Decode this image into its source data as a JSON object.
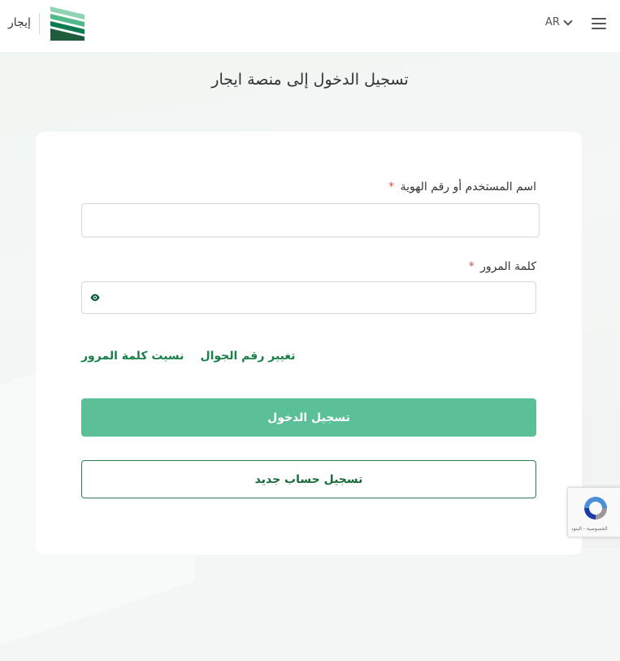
{
  "header": {
    "logo_text": "إيجار",
    "language": "AR",
    "menu_icon": "hamburger-menu-icon",
    "brand_colors": [
      "#0a7a4f",
      "#4fb98a",
      "#1f5c3d"
    ]
  },
  "page": {
    "title": "تسجيل الدخول إلى منصة ايجار"
  },
  "form": {
    "username_label": "اسم المستخدم أو رقم الهوية",
    "username_value": "",
    "password_label": "كلمة المرور",
    "password_value": "",
    "required_mark": "*",
    "eye_icon": "eye-icon",
    "change_mobile_link": "تغيير رقم الجوال",
    "forgot_password_link": "نسيت كلمة المرور",
    "login_button": "تسجيل الدخول",
    "register_button": "تسجيل حساب جديد"
  },
  "recaptcha": {
    "footer_text": "الخصوصية - البنود",
    "icon": "recaptcha-icon"
  },
  "colors": {
    "primary_button": "#5bbf98",
    "link": "#1a7f4b",
    "required": "#d9534f"
  }
}
